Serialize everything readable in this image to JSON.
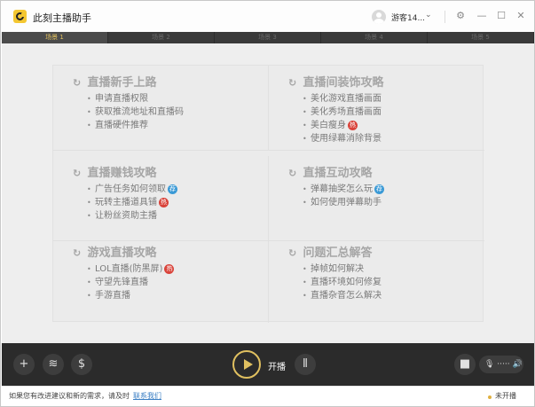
{
  "app": {
    "title": "此刻主播助手",
    "username": "游客14...",
    "user_chevron": "⌄"
  },
  "window_controls": {
    "gear_icon": "⚙",
    "minimize_icon": "—",
    "maximize_icon": "☐",
    "close_icon": "✕"
  },
  "scene_tabs": [
    {
      "label": "场景 1",
      "active": true
    },
    {
      "label": "场景 2",
      "active": false
    },
    {
      "label": "场景 3",
      "active": false
    },
    {
      "label": "场景 4",
      "active": false
    },
    {
      "label": "场景 5",
      "active": false
    }
  ],
  "guides": [
    {
      "title": "直播新手上路",
      "items": [
        {
          "label": "申请直播权限"
        },
        {
          "label": "获取推流地址和直播码"
        },
        {
          "label": "直播硬件推荐"
        }
      ]
    },
    {
      "title": "直播间装饰攻略",
      "items": [
        {
          "label": "美化游戏直播画面"
        },
        {
          "label": "美化秀场直播画面"
        },
        {
          "label": "美白瘦身",
          "badge": "热"
        },
        {
          "label": "使用绿幕消除背景"
        }
      ]
    },
    {
      "title": "直播赚钱攻略",
      "items": [
        {
          "label": "广告任务如何领取",
          "badge": "荐"
        },
        {
          "label": "玩转主播道具铺",
          "badge": "热"
        },
        {
          "label": "让粉丝资助主播"
        }
      ]
    },
    {
      "title": "直播互动攻略",
      "items": [
        {
          "label": "弹幕抽奖怎么玩",
          "badge": "荐"
        },
        {
          "label": "如何使用弹幕助手"
        }
      ]
    },
    {
      "title": "游戏直播攻略",
      "items": [
        {
          "label": "LOL直播(防黑屏)",
          "badge": "热"
        },
        {
          "label": "守望先锋直播"
        },
        {
          "label": "手游直播"
        }
      ]
    },
    {
      "title": "问题汇总解答",
      "items": [
        {
          "label": "掉帧如何解决"
        },
        {
          "label": "直播环境如何修复"
        },
        {
          "label": "直播杂音怎么解决"
        }
      ]
    }
  ],
  "guide_icon": "↻",
  "bullet": "•",
  "controls": {
    "add_icon": "+",
    "layers_icon": "≋",
    "dollar_icon": "$",
    "start_label": "开播",
    "mixer_icon": "⫴",
    "camera_icon": "■",
    "mic_icon": "🎙 ····· 🔊"
  },
  "status": {
    "message": "如果您有改进建议和新的需求，请及时",
    "contact_link": "联系我们",
    "live_status": "未开播"
  },
  "colors": {
    "accent": "#e0c060",
    "hot_badge": "#d9433a",
    "recommend_badge": "#3b9ad6"
  }
}
